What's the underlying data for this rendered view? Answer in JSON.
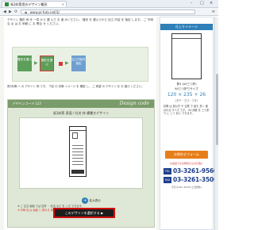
{
  "browser": {
    "tab_title": "長3封筒用のデザイン雛形",
    "tab_close": "×",
    "url": "www.pr-futo.net/3/",
    "back": "◀",
    "forward": "▶",
    "reload": "⟳",
    "menu": "≡",
    "minimize": "–",
    "maximize": "□",
    "close": "×"
  },
  "intro": {
    "text": "デザイン 雛形 例 を 一覧 から 選 んで お 進 みください。 雛形 を 選んでから 加工 内容 を 指定 します。 ご 不明 な 点 は お 気軽 に お 問合 せ ください。"
  },
  "steps": {
    "step1": "雛形を選ぶ",
    "step2": "雛形を選ぶ",
    "step3": "加工内容を指定"
  },
  "description": "長3封筒 へ の デザイン 例 です。 下記 の 封筒 イメージ を 確認 し、 ご 希望 の デザイン を お 選び ください。",
  "design": {
    "header_left": "デザインコード 123",
    "header_right": "Design code",
    "title": "長3封筒 表面 / 社名 枠 横書きデザイン",
    "zoom_label": "拡大表示"
  },
  "notes": {
    "line1": "※ ご 注文 画面 では 住所 ・ 社名 など を 入力 できます。",
    "line2": "※ 印刷 色 は 画面 と 異なる 場合 が あります。"
  },
  "cta": {
    "label": "このデザインを選択する ▶"
  },
  "sidebar": {
    "header": "仕上りイメージ",
    "size_line1": "長3 (A4三つ折)",
    "size_line2": "A4三つ折りサイズ",
    "dims": "120 × 235 + 26",
    "sub": "(タテ・ヨコ・フタ)",
    "text": "封筒 は 官公庁 や 企業 で 最も 多く 使われる サイズ です。 A4 用紙 を 三つ折り に して 封入 できます。",
    "button": "お問合せフォーム",
    "note": "お電話でのお問合せもお気軽に",
    "tel_badge": "TEL",
    "fax_badge": "FAX",
    "tel": "03-3261-9560",
    "fax": "03-3261-3506",
    "hours": "平日 9:00〜18:00 (土日祝休)"
  },
  "colors": {
    "accent_green": "#5d9e5a",
    "accent_blue": "#2f7fb8",
    "cta_red": "#d20f0f",
    "navy": "#1f3f8a",
    "orange": "#e67e1a"
  }
}
